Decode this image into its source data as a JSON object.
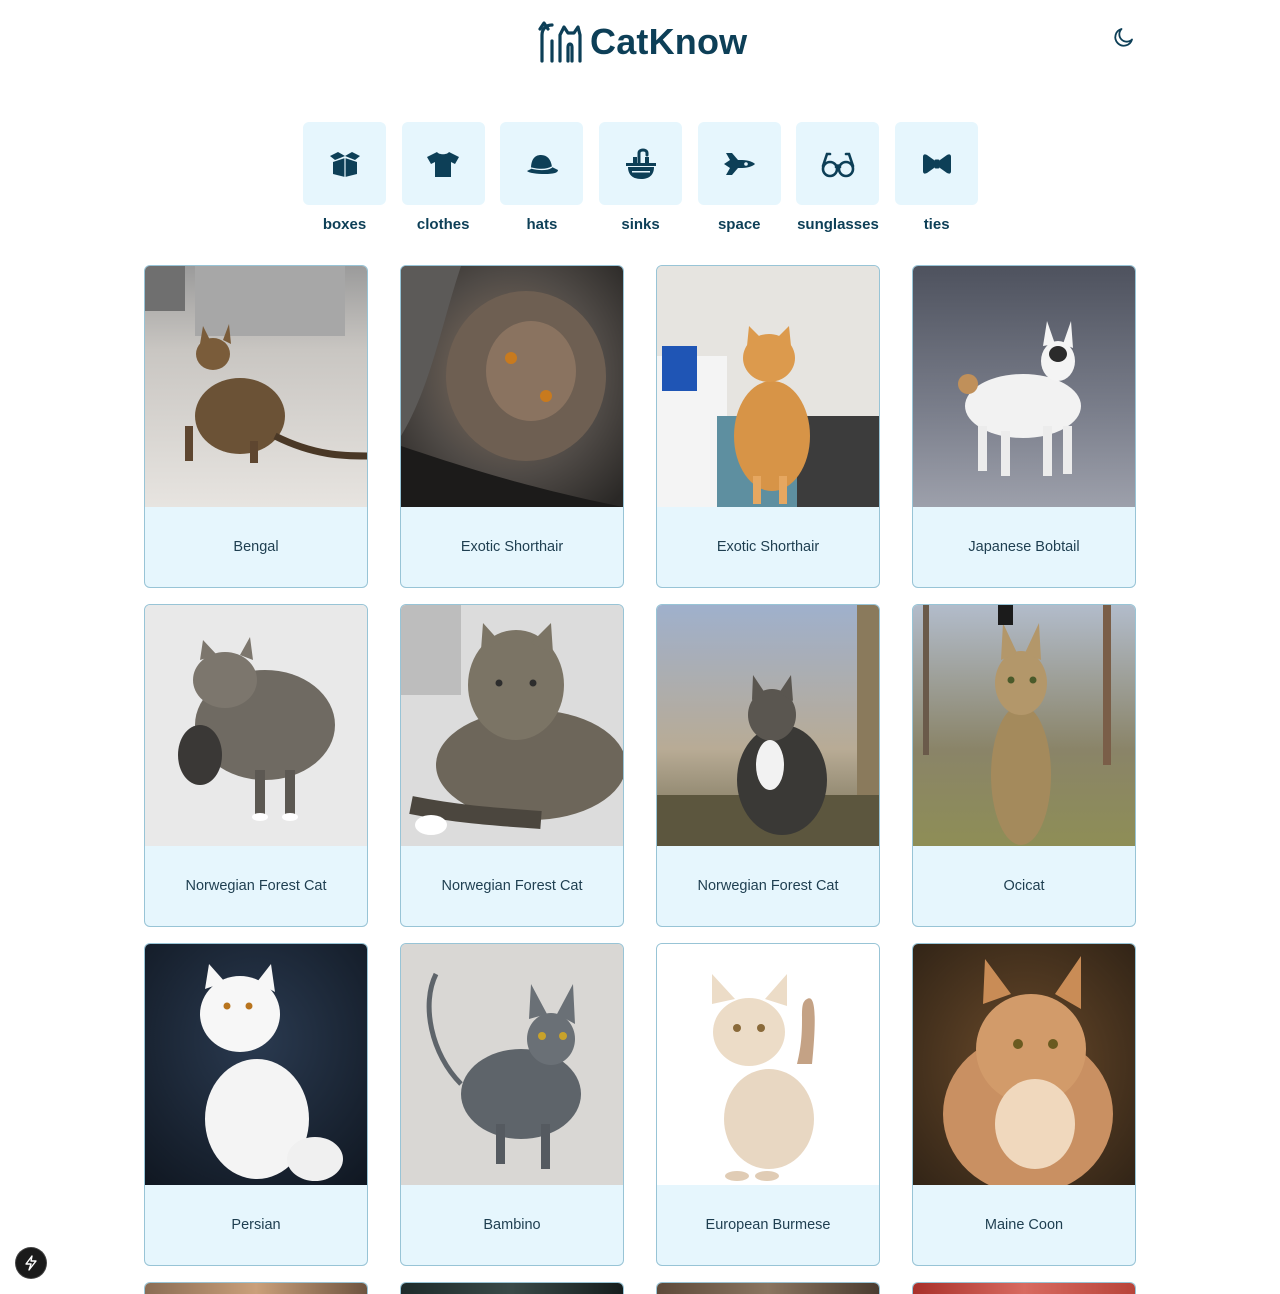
{
  "header": {
    "title": "CatKnow",
    "logo_icon": "cat-logo-icon",
    "theme_toggle_icon": "moon-icon"
  },
  "categories": [
    {
      "label": "boxes",
      "icon": "box-icon"
    },
    {
      "label": "clothes",
      "icon": "tshirt-icon"
    },
    {
      "label": "hats",
      "icon": "hat-icon"
    },
    {
      "label": "sinks",
      "icon": "sink-icon"
    },
    {
      "label": "space",
      "icon": "spaceship-icon"
    },
    {
      "label": "sunglasses",
      "icon": "glasses-icon"
    },
    {
      "label": "ties",
      "icon": "bowtie-icon"
    }
  ],
  "cats": [
    {
      "name": "Bengal"
    },
    {
      "name": "Exotic Shorthair"
    },
    {
      "name": "Exotic Shorthair"
    },
    {
      "name": "Japanese Bobtail"
    },
    {
      "name": "Norwegian Forest Cat"
    },
    {
      "name": "Norwegian Forest Cat"
    },
    {
      "name": "Norwegian Forest Cat"
    },
    {
      "name": "Ocicat"
    },
    {
      "name": "Persian"
    },
    {
      "name": "Bambino"
    },
    {
      "name": "European Burmese"
    },
    {
      "name": "Maine Coon"
    }
  ],
  "colors": {
    "brand": "#0d3f57",
    "tile_bg": "#e6f6fd",
    "card_border": "#98c4d6"
  },
  "fab_icon": "lightning-icon"
}
